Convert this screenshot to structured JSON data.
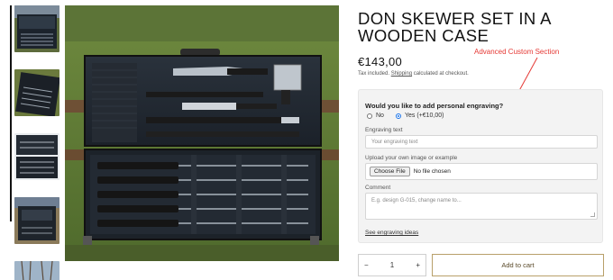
{
  "product": {
    "title": "DON SKEWER SET IN A WOODEN CASE",
    "price": "€143,00",
    "tax_prefix": "Tax included.",
    "shipping_link": "Shipping",
    "tax_suffix": "calculated at checkout."
  },
  "annotation": {
    "text": "Advanced Custom Section",
    "color": "#e53935"
  },
  "custom_section": {
    "question": "Would you like to add personal engraving?",
    "options": [
      {
        "label": "No",
        "selected": false
      },
      {
        "label": "Yes (+€10,00)",
        "selected": true
      }
    ],
    "engraving_label": "Engraving text",
    "engraving_placeholder": "Your engraving text",
    "upload_label": "Upload your own image or example",
    "file_button": "Choose File",
    "file_status": "No file chosen",
    "comment_label": "Comment",
    "comment_placeholder": "E.g. design G-015, change name to...",
    "ideas_link": "See engraving ideas"
  },
  "purchase": {
    "quantity": "1",
    "minus": "−",
    "plus": "+",
    "add_to_cart": "Add to cart"
  },
  "colors": {
    "accent_border": "#b8a06a",
    "panel_bg": "#f3f3f3"
  },
  "gallery": {
    "thumbnail_count": 5,
    "active_thumbnail": 1
  }
}
